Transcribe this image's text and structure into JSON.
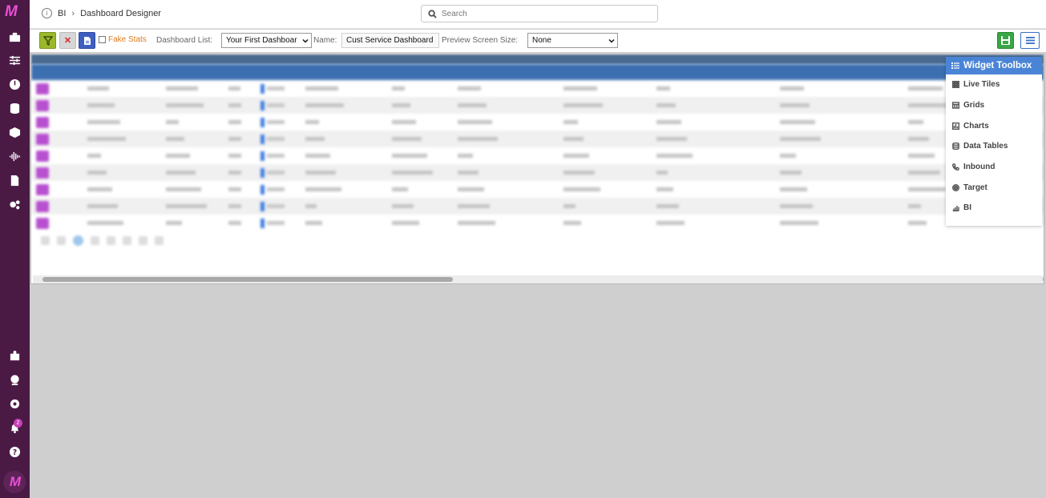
{
  "header": {
    "breadcrumb_root": "BI",
    "breadcrumb_current": "Dashboard Designer",
    "search_placeholder": "Search"
  },
  "toolbar": {
    "fake_stats_label": "Fake Stats",
    "dashboard_list_label": "Dashboard List:",
    "dashboard_list_value": "Your First Dashboar",
    "name_label": "Name:",
    "name_value": "Cust Service Dashboard",
    "preview_label": "Preview Screen Size:",
    "preview_value": "None"
  },
  "notifications": {
    "count": "2"
  },
  "widget_toolbox": {
    "title": "Widget Toolbox",
    "items": [
      {
        "label": "Live Tiles",
        "icon": "grid-dots-icon"
      },
      {
        "label": "Grids",
        "icon": "table-icon"
      },
      {
        "label": "Charts",
        "icon": "chart-icon"
      },
      {
        "label": "Data Tables",
        "icon": "database-icon"
      },
      {
        "label": "Inbound",
        "icon": "phone-icon"
      },
      {
        "label": "Target",
        "icon": "target-icon"
      },
      {
        "label": "BI",
        "icon": "bi-chart-icon"
      }
    ]
  },
  "colors": {
    "rail": "#4a1a45",
    "accent_magenta": "#e84fd6",
    "toolbox_header": "#4a84d6",
    "grid_header": "#3c6fb0"
  }
}
